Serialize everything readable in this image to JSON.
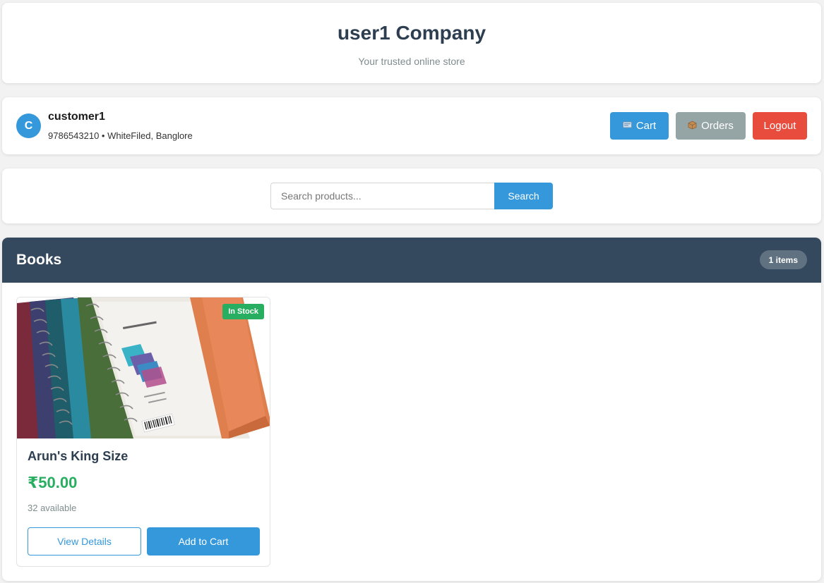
{
  "header": {
    "title": "user1 Company",
    "subtitle": "Your trusted online store"
  },
  "user": {
    "avatar_initial": "C",
    "name": "customer1",
    "info": "9786543210 • WhiteFiled, Banglore"
  },
  "nav": {
    "cart_label": "Cart",
    "orders_label": "Orders",
    "logout_label": "Logout"
  },
  "search": {
    "placeholder": "Search products...",
    "value": "",
    "button_label": "Search"
  },
  "category": {
    "title": "Books",
    "count_label": "1 items",
    "products": [
      {
        "name": "Arun's King Size",
        "price": "₹50.00",
        "availability": "32 available",
        "stock_badge": "In Stock",
        "view_label": "View Details",
        "add_label": "Add to Cart"
      }
    ]
  },
  "colors": {
    "primary": "#3498db",
    "secondary": "#95a5a6",
    "danger": "#e74c3c",
    "success": "#27ae60",
    "category_header": "#34495e",
    "heading": "#2c3e50"
  },
  "icons": {
    "cart": "cart-icon",
    "orders": "package-icon"
  }
}
